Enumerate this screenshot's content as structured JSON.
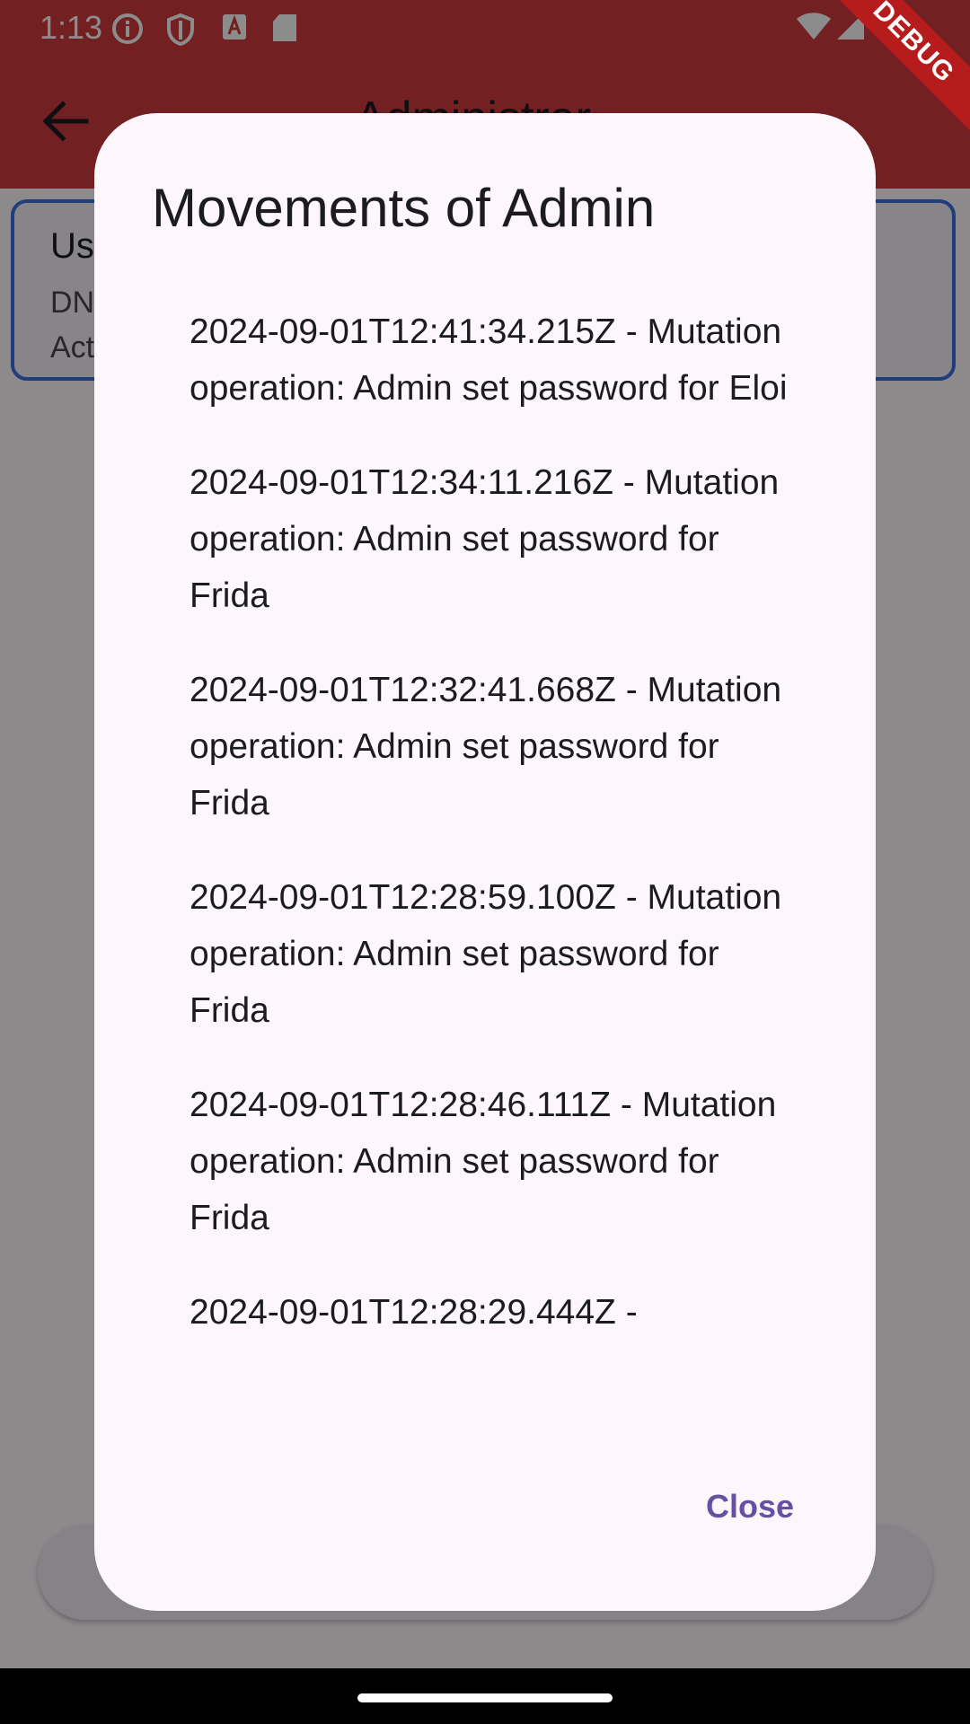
{
  "status_bar": {
    "time": "1:13"
  },
  "app_bar": {
    "title": "Administrar",
    "color": "#d23b3f"
  },
  "user_card": {
    "title": "Us",
    "line1": "DN",
    "line2": "Act"
  },
  "debug_banner": {
    "label": "DEBUG"
  },
  "dialog": {
    "title": "Movements of Admin",
    "movements": [
      "2024-09-01T12:41:34.215Z - Mutation operation: Admin set password for Eloi",
      "2024-09-01T12:34:11.216Z - Mutation operation: Admin set password for Frida",
      "2024-09-01T12:32:41.668Z - Mutation operation: Admin set password for Frida",
      "2024-09-01T12:28:59.100Z - Mutation operation: Admin set password for Frida",
      "2024-09-01T12:28:46.111Z - Mutation operation: Admin set password for Frida",
      "2024-09-01T12:28:29.444Z -"
    ],
    "close_label": "Close",
    "accent_color": "#6750a4"
  }
}
